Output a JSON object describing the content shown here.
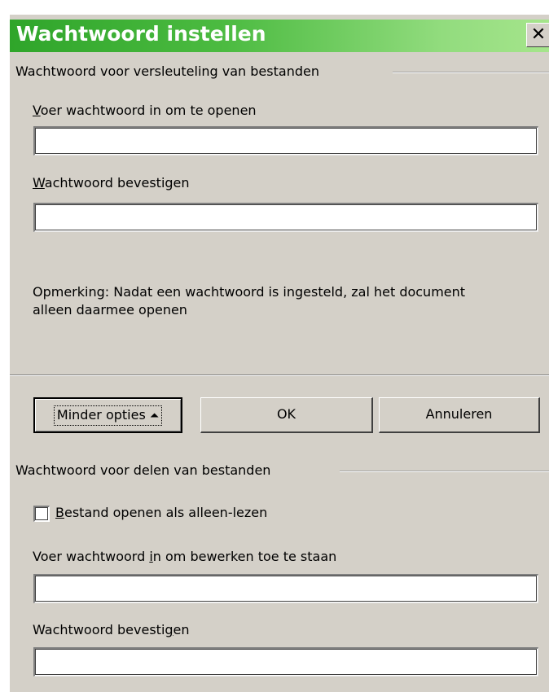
{
  "dialog": {
    "title": "Wachtwoord instellen",
    "close_glyph": "✕"
  },
  "encryption": {
    "group_label": "Wachtwoord voor versleuteling van bestanden",
    "open_label_key": "V",
    "open_label_rest": "oer wachtwoord in om te openen",
    "open_value": "",
    "confirm_label_key": "W",
    "confirm_label_rest": "achtwoord bevestigen",
    "confirm_value": "",
    "note": "Opmerking: Nadat een wachtwoord is ingesteld, zal het document alleen daarmee openen"
  },
  "buttons": {
    "fewer_options": "Minder opties",
    "fewer_options_arrow": "⏶",
    "ok": "OK",
    "cancel": "Annuleren"
  },
  "sharing": {
    "group_label": "Wachtwoord voor delen van bestanden",
    "readonly_label_key": "B",
    "readonly_label_rest": "estand openen als alleen-lezen",
    "readonly_checked": false,
    "edit_label_pre": "Voer wachtwoord ",
    "edit_label_key": "i",
    "edit_label_post": "n om bewerken toe te staan",
    "edit_value": "",
    "confirm_label_pre": "Wachtwoord bevesti",
    "confirm_label_key": "g",
    "confirm_label_post": "en",
    "confirm_value": ""
  },
  "colors": {
    "titlebar_start": "#2fa52a",
    "titlebar_end": "#a6e58c",
    "dialog_bg": "#d4d0c8"
  }
}
